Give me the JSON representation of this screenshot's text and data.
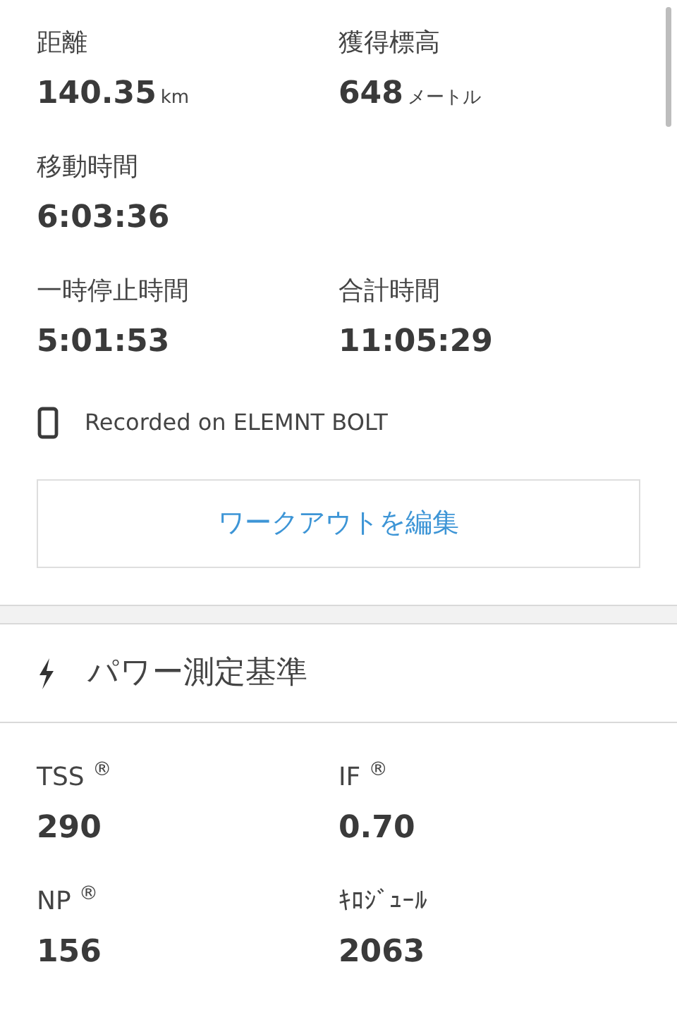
{
  "stats_rows": [
    [
      {
        "label": "距離",
        "value": "140.35",
        "unit": "km"
      },
      {
        "label": "獲得標高",
        "value": "648",
        "unit": "メートル"
      }
    ],
    [
      {
        "label": "移動時間",
        "value": "6:03:36"
      }
    ],
    [
      {
        "label": "一時停止時間",
        "value": "5:01:53"
      },
      {
        "label": "合計時間",
        "value": "11:05:29"
      }
    ]
  ],
  "device": {
    "text": "Recorded on ELEMNT BOLT"
  },
  "edit_button": {
    "label": "ワークアウトを編集"
  },
  "power_section": {
    "title": "パワー測定基準",
    "metrics": [
      {
        "label": "TSS $^{®}$",
        "value": "290"
      },
      {
        "label": "IF $^{®}$",
        "value": "0.70"
      },
      {
        "label": "NP $^{®}$",
        "value": "156"
      },
      {
        "label": "ｷﾛｼﾞｭｰﾙ",
        "value": "2063"
      }
    ]
  }
}
